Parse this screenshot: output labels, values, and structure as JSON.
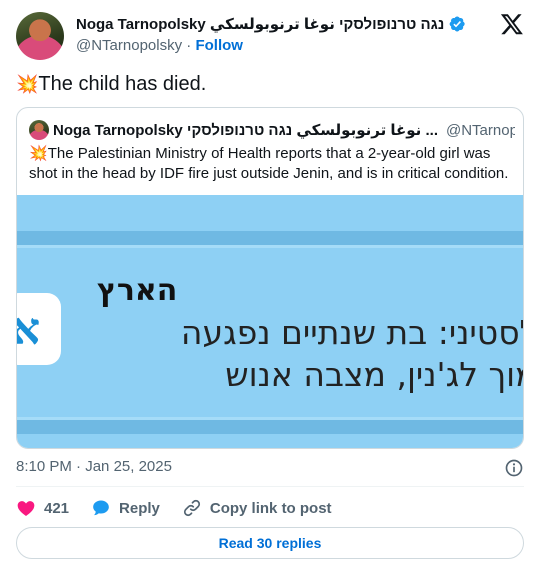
{
  "author": {
    "name": "Noga Tarnopolsky נגה טרנופולסקי نوغا ترنوبولسكي",
    "handle": "@NTarnopolsky",
    "separator": "·",
    "follow_label": "Follow"
  },
  "tweet": {
    "emoji": "💥",
    "text": "The child has died."
  },
  "quoted_tweet": {
    "name": "Noga Tarnopolsky نوغا ترنوبولسكي נגה טרנופולסקי ...",
    "handle": "@NTarnopol...",
    "emoji": "💥",
    "text": "The Palestinian Ministry of Health reports that a 2-year-old girl was shot in the head by IDF fire just outside Jenin, and is in critical condition.",
    "image": {
      "title": "הארץ",
      "line1": "פלסטיני: בת שנתיים נפגעה",
      "line2": "סמוך לג'נין, מצבה אנוש",
      "icon_glyph": "א"
    }
  },
  "meta": {
    "time": "8:10 PM",
    "separator": "·",
    "date": "Jan 25, 2025"
  },
  "actions": {
    "like_count": "421",
    "reply_label": "Reply",
    "copy_label": "Copy link to post"
  },
  "read_replies_label": "Read 30 replies",
  "icons": {
    "verified": "verified-badge-icon",
    "x_logo": "x-logo-icon",
    "info": "info-icon",
    "like": "heart-icon",
    "reply": "reply-bubble-icon",
    "copy": "link-icon"
  },
  "colors": {
    "accent": "#006fd6",
    "verified": "#1d9bf0",
    "heart": "#f91880",
    "text_secondary": "#536471",
    "image_background": "#8ed0f4"
  }
}
